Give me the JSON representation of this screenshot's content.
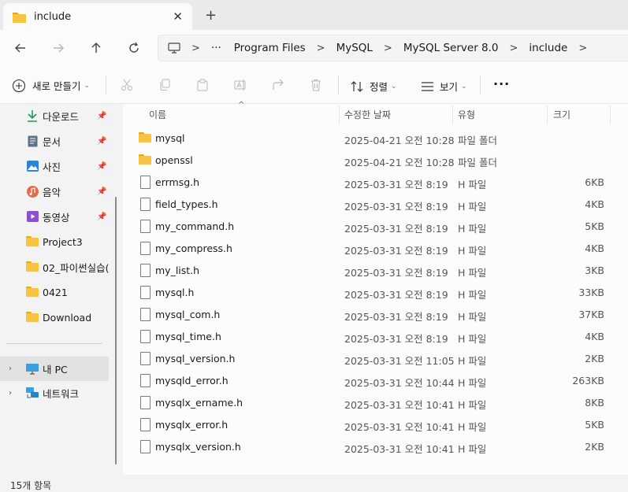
{
  "tab": {
    "title": "include",
    "close_icon": "close-icon",
    "new_tab_icon": "plus-icon"
  },
  "nav": {
    "back": "back-arrow-icon",
    "forward": "forward-arrow-icon",
    "up": "up-arrow-icon",
    "refresh": "refresh-icon"
  },
  "breadcrumb": {
    "more": "···",
    "items": [
      "Program Files",
      "MySQL",
      "MySQL Server 8.0",
      "include"
    ],
    "separator": ">"
  },
  "toolbar": {
    "new_label": "새로 만들기",
    "sort_label": "정렬",
    "view_label": "보기",
    "more_label": "···"
  },
  "sidebar": {
    "items": [
      {
        "label": "다운로드",
        "icon": "download-icon",
        "pinned": true
      },
      {
        "label": "문서",
        "icon": "document-icon",
        "pinned": true
      },
      {
        "label": "사진",
        "icon": "picture-icon",
        "pinned": true
      },
      {
        "label": "음악",
        "icon": "music-icon",
        "pinned": true
      },
      {
        "label": "동영상",
        "icon": "video-icon",
        "pinned": true
      },
      {
        "label": "Project3",
        "icon": "folder-icon",
        "pinned": false
      },
      {
        "label": "02_파이썬실습(",
        "icon": "folder-icon",
        "pinned": false
      },
      {
        "label": "0421",
        "icon": "folder-icon",
        "pinned": false
      },
      {
        "label": "Download",
        "icon": "folder-icon",
        "pinned": false
      }
    ],
    "this_pc": "내 PC",
    "network": "네트워크"
  },
  "columns": {
    "name": "이름",
    "modified": "수정한 날짜",
    "type": "유형",
    "size": "크기"
  },
  "files": [
    {
      "name": "mysql",
      "modified": "2025-04-21 오전 10:28",
      "type": "파일 폴더",
      "size": "",
      "kind": "folder"
    },
    {
      "name": "openssl",
      "modified": "2025-04-21 오전 10:28",
      "type": "파일 폴더",
      "size": "",
      "kind": "folder"
    },
    {
      "name": "errmsg.h",
      "modified": "2025-03-31 오전 8:19",
      "type": "H 파일",
      "size": "6KB",
      "kind": "file"
    },
    {
      "name": "field_types.h",
      "modified": "2025-03-31 오전 8:19",
      "type": "H 파일",
      "size": "4KB",
      "kind": "file"
    },
    {
      "name": "my_command.h",
      "modified": "2025-03-31 오전 8:19",
      "type": "H 파일",
      "size": "5KB",
      "kind": "file"
    },
    {
      "name": "my_compress.h",
      "modified": "2025-03-31 오전 8:19",
      "type": "H 파일",
      "size": "4KB",
      "kind": "file"
    },
    {
      "name": "my_list.h",
      "modified": "2025-03-31 오전 8:19",
      "type": "H 파일",
      "size": "3KB",
      "kind": "file"
    },
    {
      "name": "mysql.h",
      "modified": "2025-03-31 오전 8:19",
      "type": "H 파일",
      "size": "33KB",
      "kind": "file"
    },
    {
      "name": "mysql_com.h",
      "modified": "2025-03-31 오전 8:19",
      "type": "H 파일",
      "size": "37KB",
      "kind": "file"
    },
    {
      "name": "mysql_time.h",
      "modified": "2025-03-31 오전 8:19",
      "type": "H 파일",
      "size": "4KB",
      "kind": "file"
    },
    {
      "name": "mysql_version.h",
      "modified": "2025-03-31 오전 11:05",
      "type": "H 파일",
      "size": "2KB",
      "kind": "file"
    },
    {
      "name": "mysqld_error.h",
      "modified": "2025-03-31 오전 10:44",
      "type": "H 파일",
      "size": "263KB",
      "kind": "file"
    },
    {
      "name": "mysqlx_ername.h",
      "modified": "2025-03-31 오전 10:41",
      "type": "H 파일",
      "size": "8KB",
      "kind": "file"
    },
    {
      "name": "mysqlx_error.h",
      "modified": "2025-03-31 오전 10:41",
      "type": "H 파일",
      "size": "5KB",
      "kind": "file"
    },
    {
      "name": "mysqlx_version.h",
      "modified": "2025-03-31 오전 10:41",
      "type": "H 파일",
      "size": "2KB",
      "kind": "file"
    }
  ],
  "status": {
    "count_label": "15개 항목"
  },
  "colors": {
    "folder": "#f6c343",
    "accent": "#0067c0"
  }
}
